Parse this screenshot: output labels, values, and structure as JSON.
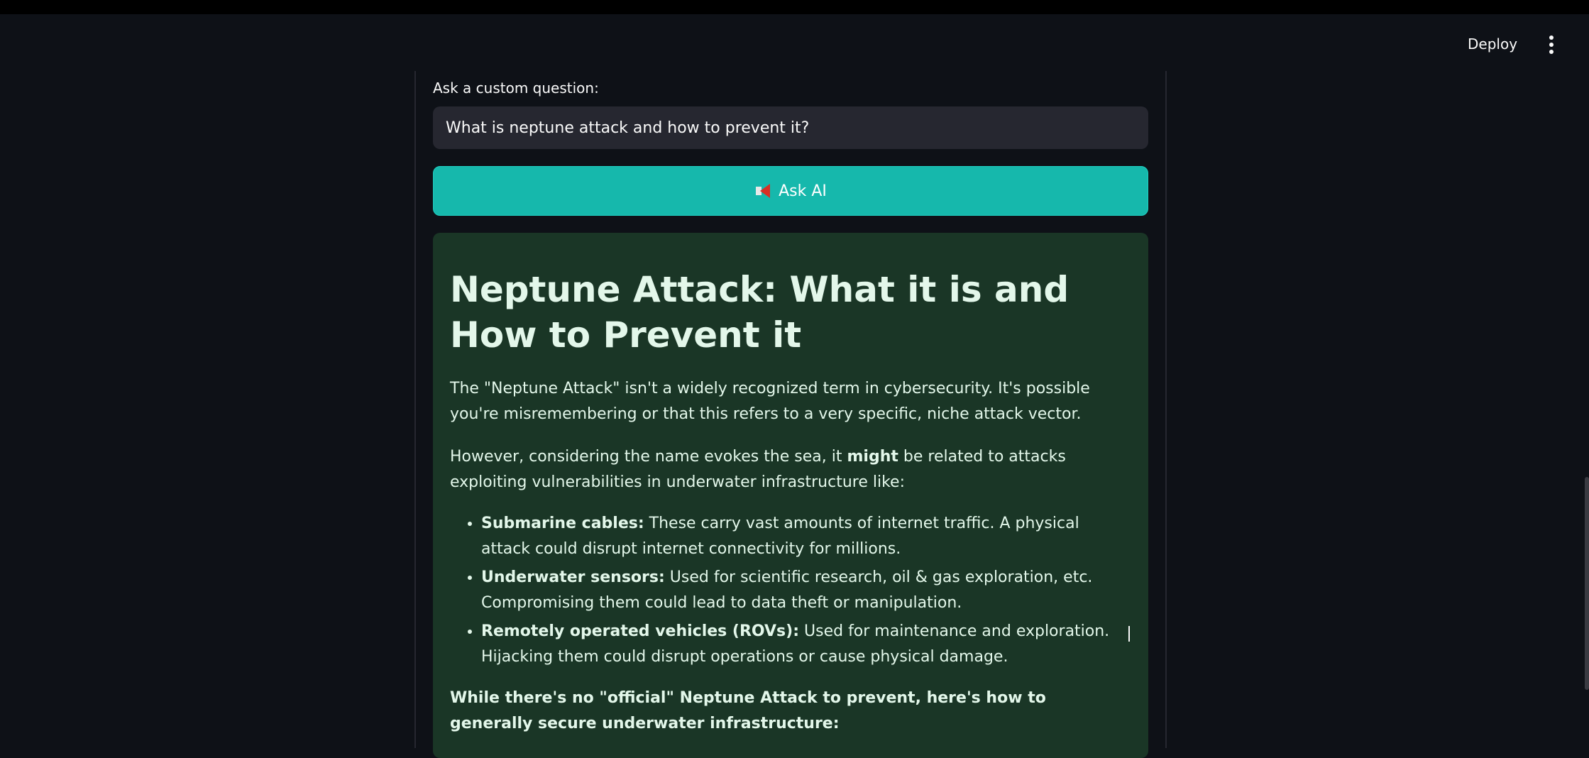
{
  "header": {
    "deploy_label": "Deploy",
    "menu_icon": "kebab-menu-icon"
  },
  "form": {
    "label": "Ask a custom question:",
    "question_value": "What is neptune attack and how to prevent it?",
    "button_label": "Ask AI",
    "button_icon": "megaphone-icon"
  },
  "response": {
    "title": "Neptune Attack: What it is and How to Prevent it",
    "para1": "The \"Neptune Attack\" isn't a widely recognized term in cybersecurity. It's possible you're misremembering or that this refers to a very specific, niche attack vector.",
    "para2_before": "However, considering the name evokes the sea, it ",
    "para2_bold": "might",
    "para2_after": " be related to attacks exploiting vulnerabilities in underwater infrastructure like:",
    "bullets": [
      {
        "term": "Submarine cables:",
        "text": " These carry vast amounts of internet traffic. A physical attack could disrupt internet connectivity for millions."
      },
      {
        "term": "Underwater sensors:",
        "text": " Used for scientific research, oil & gas exploration, etc. Compromising them could lead to data theft or manipulation."
      },
      {
        "term": "Remotely operated vehicles (ROVs):",
        "text": " Used for maintenance and exploration. Hijacking them could disrupt operations or cause physical damage."
      }
    ],
    "closing": "While there's no \"official\" Neptune Attack to prevent, here's how to generally secure underwater infrastructure:"
  },
  "colors": {
    "background": "#0e1117",
    "button": "#16b8ac",
    "response_bg": "#1a3626",
    "input_bg": "#262730"
  }
}
